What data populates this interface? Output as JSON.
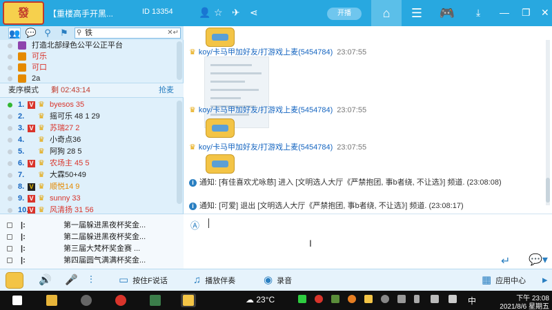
{
  "titlebar": {
    "logo_text": "發",
    "room_title": "【重楼高手开黑...",
    "room_id": "ID 13354",
    "kaibo_label": "开播",
    "icons": [
      "person-icon",
      "star-icon",
      "plane-icon",
      "share-icon"
    ],
    "tabs": [
      "home-icon",
      "list-icon",
      "gamepad-icon"
    ],
    "window_controls": [
      "download-icon",
      "minimize-icon",
      "restore-icon",
      "close-icon"
    ]
  },
  "sidebar": {
    "search_value": "铁",
    "channels": [
      {
        "label": "打造北部绿色公平公正平台",
        "color": "#222",
        "icon_color": "#8e44ad"
      },
      {
        "label": "可乐",
        "color": "#d9342b",
        "icon_color": "#e58a00"
      },
      {
        "label": "可口",
        "color": "#d9342b",
        "icon_color": "#e58a00"
      },
      {
        "label": "2a",
        "color": "#222",
        "icon_color": "#e58a00"
      }
    ],
    "mode_label": "麦序模式",
    "mode_time": "剩 02:43:14",
    "grab_label": "抢麦",
    "queue": [
      {
        "num": "1.",
        "name": "byesos 35",
        "dot": "green",
        "v": "red",
        "style": "red"
      },
      {
        "num": "2.",
        "name": "摇可乐 48 1 29",
        "dot": "grey",
        "v": "",
        "style": "dark"
      },
      {
        "num": "3.",
        "name": "苏瑞27 2",
        "dot": "grey",
        "v": "red",
        "style": "red"
      },
      {
        "num": "4.",
        "name": "小奇点36",
        "dot": "grey",
        "v": "",
        "style": "dark"
      },
      {
        "num": "5.",
        "name": "阿狗 28 5",
        "dot": "grey",
        "v": "",
        "style": "dark"
      },
      {
        "num": "6.",
        "name": "农场主 45 5",
        "dot": "grey",
        "v": "red",
        "style": "red"
      },
      {
        "num": "7.",
        "name": "大霖50+49",
        "dot": "grey",
        "v": "",
        "style": "dark"
      },
      {
        "num": "8.",
        "name": "顺悦14 9",
        "dot": "grey",
        "v": "black",
        "style": "orange"
      },
      {
        "num": "9.",
        "name": "sunny 33",
        "dot": "grey",
        "v": "red",
        "style": "red"
      },
      {
        "num": "10.",
        "name": "风清扬 31 56",
        "dot": "grey",
        "v": "red",
        "style": "red"
      }
    ],
    "cups": [
      {
        "mark": "|:",
        "label": "第一届躲进黑夜杯奖金..."
      },
      {
        "mark": "|:",
        "label": "第二届躲进黑夜杯奖金..."
      },
      {
        "mark": "|:",
        "label": "第三届大梵杯奖金赛 ..."
      },
      {
        "mark": "|:",
        "label": "第四届圆气满满杯奖金..."
      }
    ]
  },
  "chat": {
    "messages": [
      {
        "user": "koy/卡马甲加好友/打游戏上麦(5454784)",
        "time": "23:07:55"
      },
      {
        "user": "koy/卡马甲加好友/打游戏上麦(5454784)",
        "time": "23:07:55"
      },
      {
        "user": "koy/卡马甲加好友/打游戏上麦(5454784)",
        "time": "23:07:55"
      }
    ],
    "notices": [
      {
        "text": "通知: [有佳喜欢尤咏慈] 进入 [文明选人大厅《严禁抱团, 事b者绕, 不让选》] 频道. (23:08:08)"
      },
      {
        "text": "通知: [可爱] 退出 [文明选人大厅《严禁抱团, 事b者绕, 不让选》] 频道. (23:08:17)"
      }
    ]
  },
  "toolbar": {
    "f_speak": "按住F说话",
    "accompany": "播放伴奏",
    "record": "录音",
    "app_center": "应用中心"
  },
  "taskbar": {
    "weather": "23°C",
    "ime": "中",
    "time_label": "下午 23:08",
    "date_label": "2021/8/6 星期五"
  }
}
